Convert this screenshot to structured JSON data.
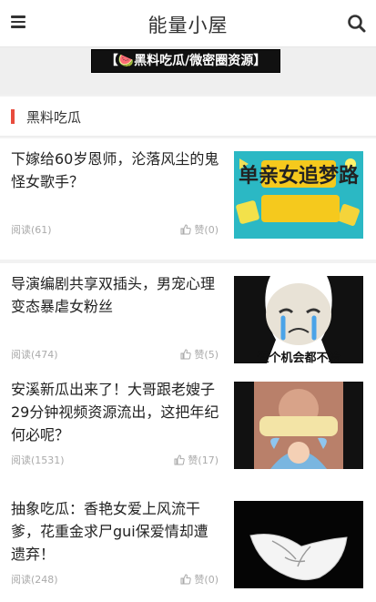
{
  "header": {
    "title": "能量小屋",
    "menu_icon": "hamburger-menu-icon",
    "search_icon": "search-icon"
  },
  "banner": {
    "text": "【🍉黑料吃瓜/微密圈资源】",
    "icon": "watermelon-icon",
    "background": "#111111"
  },
  "section": {
    "title": "黑料吃瓜",
    "accent": "#e84c3d"
  },
  "articles": [
    {
      "title": "下嫁给60岁恩师，沦落风尘的鬼怪女歌手？",
      "reads": "阅读(61)",
      "likes": "赞(0)",
      "thumb_text": "单亲女追梦路"
    },
    {
      "title": "导演编剧共享双插头，男宠心理变态暴虐女粉丝",
      "reads": "阅读(474)",
      "likes": "赞(5)",
      "thumb_text": "连个机会都不给"
    },
    {
      "title": "安溪新瓜出来了！大哥跟老嫂子29分钟视频资源流出，这把年纪何必呢？",
      "reads": "阅读(1531)",
      "likes": "赞(17)"
    },
    {
      "title": "抽象吃瓜：香艳女爱上风流干爹，花重金求尸gui保爱情却遭遗弃！",
      "reads": "阅读(248)",
      "likes": "赞(0)"
    }
  ]
}
